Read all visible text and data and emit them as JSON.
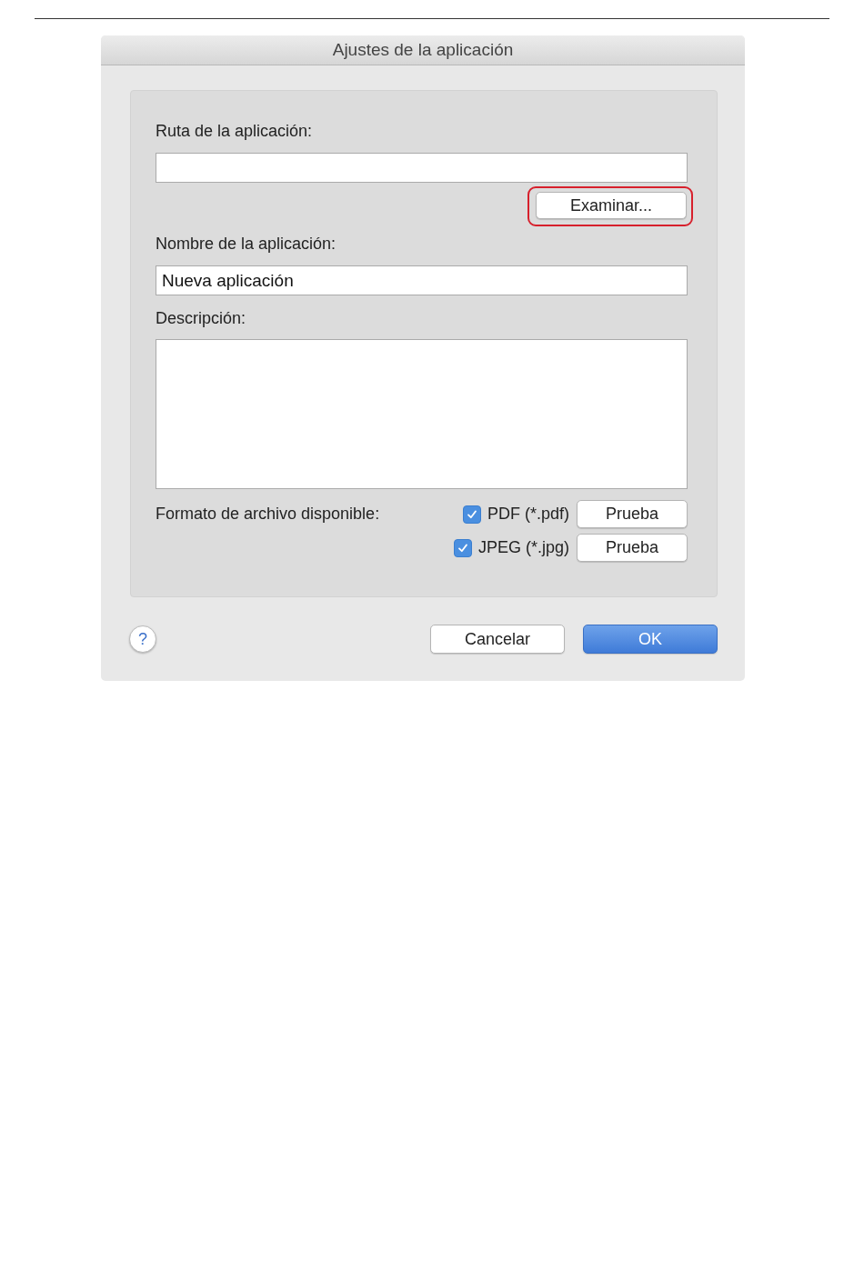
{
  "window": {
    "title": "Ajustes de la aplicación"
  },
  "app_path": {
    "label": "Ruta de la aplicación:",
    "browse_button": {
      "label": "Examinar...",
      "highlighted": true
    }
  },
  "app_name": {
    "label": "Nombre de la aplicación:",
    "value": "Nueva aplicación"
  },
  "description": {
    "label": "Descripción:"
  },
  "file_formats": {
    "label": "Formato de archivo disponible:",
    "items": [
      {
        "label": "PDF (*.pdf)",
        "checked": true,
        "button": "Prueba"
      },
      {
        "label": "JPEG (*.jpg)",
        "checked": true,
        "button": "Prueba"
      }
    ]
  },
  "help_button": "?",
  "buttons": [
    {
      "label": "Cancelar",
      "kind": "secondary"
    },
    {
      "label": "OK",
      "kind": "primary"
    }
  ]
}
